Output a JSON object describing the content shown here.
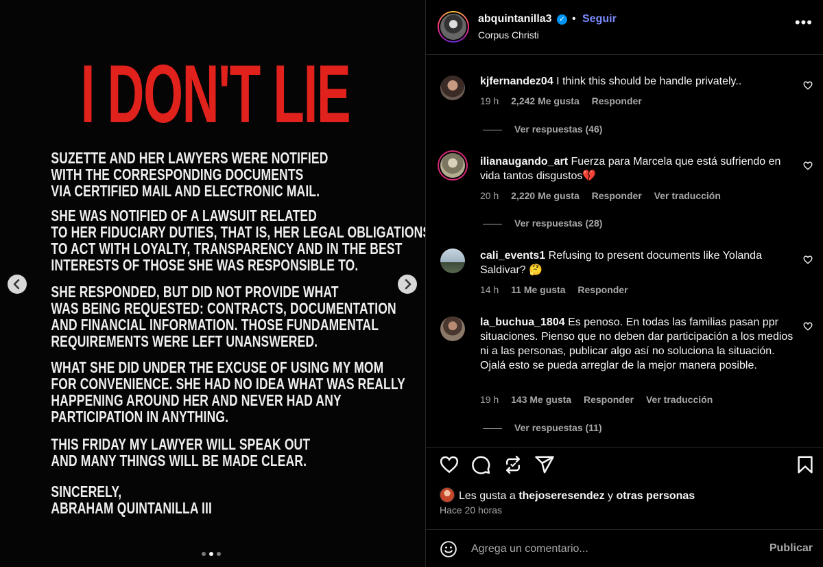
{
  "post": {
    "headline": "I DON'T LIE",
    "paragraphs": [
      [
        "SUZETTE AND HER LAWYERS WERE NOTIFIED",
        "WITH THE CORRESPONDING DOCUMENTS",
        "VIA CERTIFIED MAIL AND ELECTRONIC MAIL."
      ],
      [
        "SHE WAS NOTIFIED OF A LAWSUIT RELATED",
        "TO HER FIDUCIARY DUTIES, THAT IS, HER LEGAL OBLIGATIONS",
        "TO ACT WITH LOYALTY, TRANSPARENCY AND IN THE BEST",
        "INTERESTS OF THOSE SHE WAS RESPONSIBLE TO."
      ],
      [
        "SHE RESPONDED, BUT DID NOT PROVIDE WHAT",
        "WAS BEING REQUESTED: CONTRACTS, DOCUMENTATION",
        "AND FINANCIAL INFORMATION. THOSE FUNDAMENTAL",
        "REQUIREMENTS WERE LEFT UNANSWERED."
      ],
      [
        "WHAT SHE DID UNDER THE EXCUSE OF USING MY MOM",
        "FOR CONVENIENCE. SHE HAD NO IDEA WHAT WAS REALLY",
        "HAPPENING AROUND HER AND NEVER HAD ANY",
        "PARTICIPATION IN ANYTHING."
      ],
      [
        "THIS FRIDAY MY LAWYER WILL SPEAK OUT",
        "AND MANY THINGS WILL BE MADE CLEAR."
      ],
      [
        "SINCERELY,",
        "ABRAHAM QUINTANILLA III"
      ]
    ],
    "prev_icon": "chevron-left-icon",
    "next_icon": "chevron-right-icon",
    "carousel_index": 2,
    "carousel_total": 3
  },
  "header": {
    "username": "abquintanilla3",
    "verified_icon": "verified-badge-icon",
    "separator": "•",
    "follow_label": "Seguir",
    "location": "Corpus Christi",
    "more_icon": "more-options-icon",
    "more_label": "•••"
  },
  "comments": [
    {
      "user": "kjfernandez04",
      "text": "I think this should be handle privately..",
      "time": "19 h",
      "likes": "2,242 Me gusta",
      "reply": "Responder",
      "translate": "",
      "replies": "Ver respuestas (46)"
    },
    {
      "user": "ilianaugando_art",
      "text": "Fuerza para Marcela que está sufriendo en vida tantos disgustos💔",
      "time": "20 h",
      "likes": "2,220 Me gusta",
      "reply": "Responder",
      "translate": "Ver traducción",
      "replies": "Ver respuestas (28)"
    },
    {
      "user": "cali_events1",
      "text": "Refusing to present documents like Yolanda Saldivar? 🤔",
      "time": "14 h",
      "likes": "11 Me gusta",
      "reply": "Responder",
      "translate": "",
      "replies": ""
    },
    {
      "user": "la_buchua_1804",
      "text": "Es penoso. En todas las familias pasan ppr situaciones. Pienso que no deben dar participación a los medios ni a las personas, publicar algo así no soluciona la situación. Ojalá esto se pueda arreglar de la mejor manera posible.",
      "time": "19 h",
      "likes": "143 Me gusta",
      "reply": "Responder",
      "translate": "Ver traducción",
      "replies": "Ver respuestas (11)"
    }
  ],
  "actions": {
    "like_icon": "heart-icon",
    "comment_icon": "comment-bubble-icon",
    "repost_icon": "repost-icon",
    "share_icon": "send-icon",
    "save_icon": "bookmark-icon"
  },
  "likes": {
    "prefix": "Les gusta a",
    "user": "thejoseresendez",
    "conj": "y",
    "others": "otras personas"
  },
  "time_ago": "Hace 20 horas",
  "composer": {
    "emoji_icon": "emoji-smiley-icon",
    "placeholder": "Agrega un comentario...",
    "publish_label": "Publicar"
  }
}
